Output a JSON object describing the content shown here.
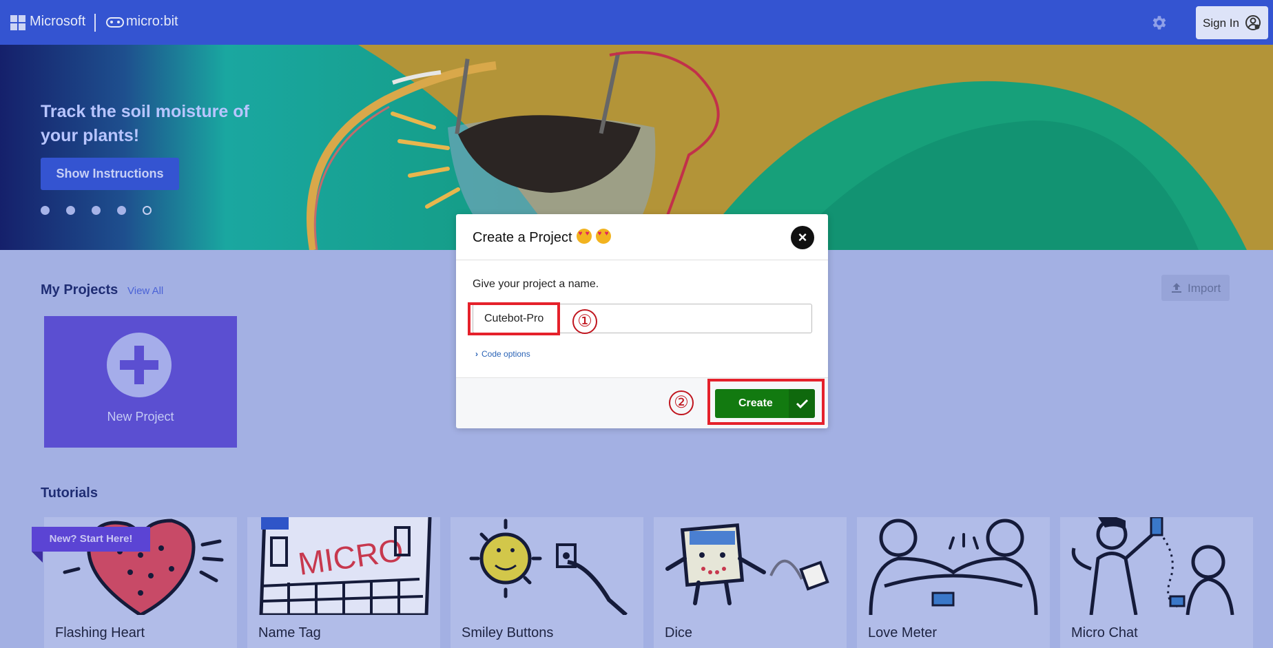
{
  "header": {
    "microsoft_label": "Microsoft",
    "brand_label": "micro:bit",
    "signin_label": "Sign In"
  },
  "hero": {
    "title": "Track the soil moisture of your plants!",
    "button_label": "Show Instructions",
    "dot_count": 5,
    "active_dot": 5
  },
  "projects": {
    "title": "My Projects",
    "view_all": "View All",
    "import_label": "Import",
    "new_project_label": "New Project"
  },
  "tutorials": {
    "title": "Tutorials",
    "badge": "New? Start Here!",
    "cards": [
      {
        "label": "Flashing Heart"
      },
      {
        "label": "Name Tag"
      },
      {
        "label": "Smiley Buttons"
      },
      {
        "label": "Dice"
      },
      {
        "label": "Love Meter"
      },
      {
        "label": "Micro Chat"
      }
    ]
  },
  "dialog": {
    "title": "Create a Project",
    "prompt": "Give your project a name.",
    "name_value": "Cutebot-Pro",
    "code_options": "Code options",
    "create_label": "Create"
  },
  "annotations": {
    "step1": "①",
    "step2": "②"
  },
  "colors": {
    "topbar": "#3454d1",
    "create_green": "#127a10",
    "highlight_red": "#e5212b",
    "new_project_purple": "#5b4fd1"
  }
}
